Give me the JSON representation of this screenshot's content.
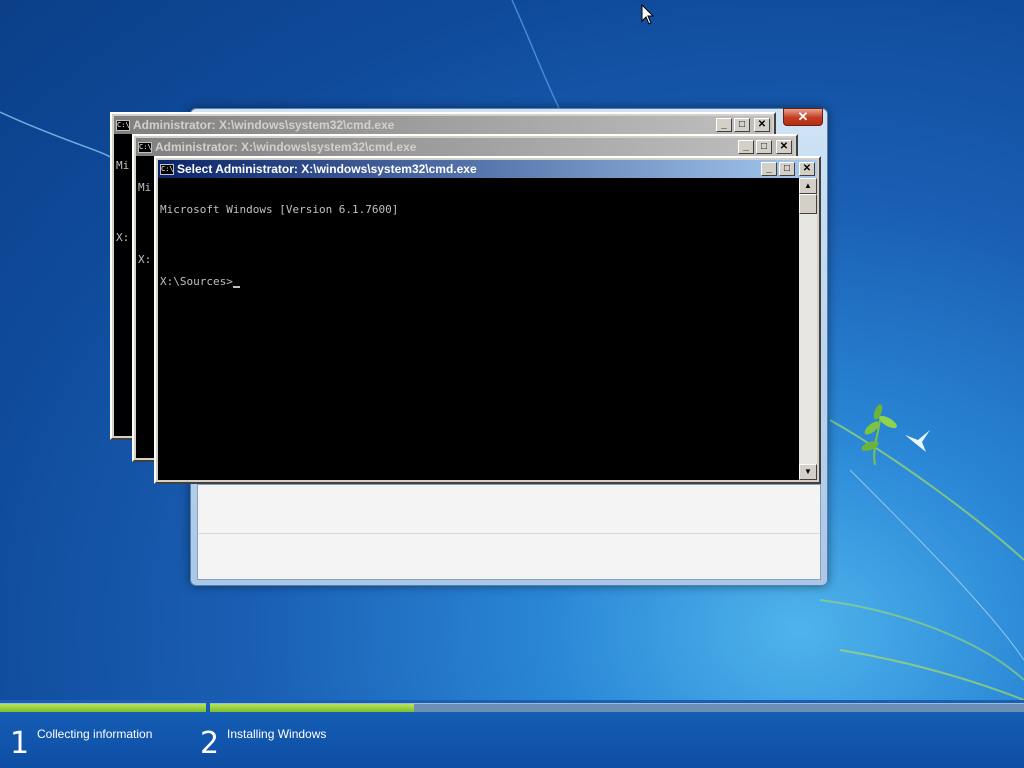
{
  "desktop": {
    "background_color": "#1a5fb4",
    "accent_color": "#7cc243"
  },
  "setup_window": {
    "close_label": "✕"
  },
  "cmd_windows": [
    {
      "title": "Administrator: X:\\windows\\system32\\cmd.exe",
      "icon_label": "C:\\",
      "visible_lines": [
        "Mi",
        "",
        "X:"
      ],
      "controls": [
        "_",
        "□",
        "✕"
      ]
    },
    {
      "title": "Administrator: X:\\windows\\system32\\cmd.exe",
      "icon_label": "C:\\",
      "visible_lines": [
        "Mi",
        "",
        "X:"
      ],
      "controls": [
        "_",
        "□",
        "✕"
      ]
    },
    {
      "title": "Select Administrator: X:\\windows\\system32\\cmd.exe",
      "icon_label": "C:\\",
      "lines": [
        "Microsoft Windows [Version 6.1.7600]",
        "",
        "X:\\Sources>"
      ],
      "controls": [
        "_",
        "□",
        "✕"
      ],
      "scroll_up": "▲",
      "scroll_down": "▼"
    }
  ],
  "setup_progress": {
    "steps": [
      {
        "number": "1",
        "label": "Collecting information",
        "progress": 1.0
      },
      {
        "number": "2",
        "label": "Installing Windows",
        "progress": 0.25
      }
    ]
  }
}
